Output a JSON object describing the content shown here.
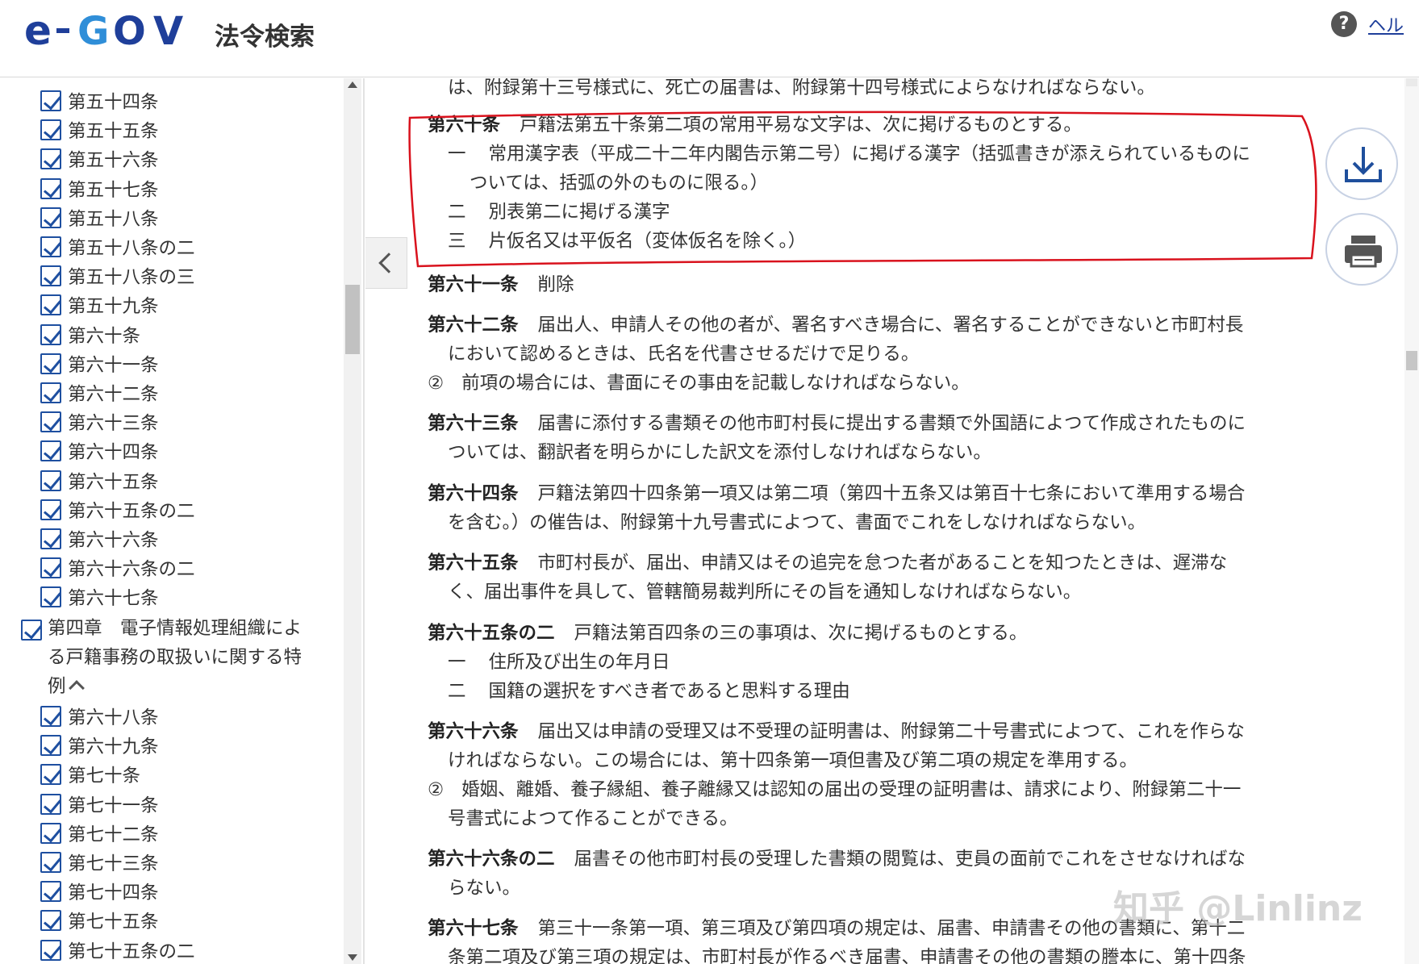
{
  "header": {
    "logo_text": "e-GOV",
    "site_title": "法令検索",
    "help_label": "ヘル"
  },
  "sidebar": {
    "items_top": [
      "第五十四条",
      "第五十五条",
      "第五十六条",
      "第五十七条",
      "第五十八条",
      "第五十八条の二",
      "第五十八条の三",
      "第五十九条",
      "第六十条",
      "第六十一条",
      "第六十二条",
      "第六十三条",
      "第六十四条",
      "第六十五条",
      "第六十五条の二",
      "第六十六条",
      "第六十六条の二",
      "第六十七条"
    ],
    "chapter": {
      "line1": "第四章　電子情報処理組織によ",
      "line2": "る戸籍事務の取扱いに関する特",
      "line3": "例"
    },
    "items_bottom": [
      "第六十八条",
      "第六十九条",
      "第七十条",
      "第七十一条",
      "第七十二条",
      "第七十三条",
      "第七十四条",
      "第七十五条",
      "第七十五条の二"
    ]
  },
  "content": {
    "top_fragment": "は、附録第十三号様式に、死亡の届書は、附録第十四号様式によらなければならない。",
    "a60": {
      "num": "第六十条",
      "text": "戸籍法第五十条第二項の常用平易な文字は、次に掲げるものとする。",
      "items": [
        {
          "n": "一",
          "line1": "常用漢字表（平成二十二年内閣告示第二号）に掲げる漢字（括弧書きが添えられているものに",
          "line2": "ついては、括弧の外のものに限る。）"
        },
        {
          "n": "二",
          "line1": "別表第二に掲げる漢字",
          "line2": ""
        },
        {
          "n": "三",
          "line1": "片仮名又は平仮名（変体仮名を除く。）",
          "line2": ""
        }
      ]
    },
    "a61": {
      "num": "第六十一条",
      "text": "削除"
    },
    "a62": {
      "num": "第六十二条",
      "line1": "届出人、申請人その他の者が、署名すべき場合に、署名することができないと市町村長",
      "line2": "において認めるときは、氏名を代書させるだけで足りる。",
      "para2_mark": "②",
      "para2": "前項の場合には、書面にその事由を記載しなければならない。"
    },
    "a63": {
      "num": "第六十三条",
      "line1": "届書に添付する書類その他市町村長に提出する書類で外国語によつて作成されたものに",
      "line2": "ついては、翻訳者を明らかにした訳文を添付しなければならない。"
    },
    "a64": {
      "num": "第六十四条",
      "line1": "戸籍法第四十四条第一項又は第二項（第四十五条又は第百十七条において準用する場合",
      "line2": "を含む。）の催告は、附録第十九号書式によつて、書面でこれをしなければならない。"
    },
    "a65": {
      "num": "第六十五条",
      "line1": "市町村長が、届出、申請又はその追完を怠つた者があることを知つたときは、遅滞な",
      "line2": "く、届出事件を具して、管轄簡易裁判所にその旨を通知しなければならない。"
    },
    "a65_2": {
      "num": "第六十五条の二",
      "text": "戸籍法第百四条の三の事項は、次に掲げるものとする。",
      "items": [
        {
          "n": "一",
          "text": "住所及び出生の年月日"
        },
        {
          "n": "二",
          "text": "国籍の選択をすべき者であると思料する理由"
        }
      ]
    },
    "a66": {
      "num": "第六十六条",
      "line1": "届出又は申請の受理又は不受理の証明書は、附録第二十号書式によつて、これを作らな",
      "line2": "ければならない。この場合には、第十四条第一項但書及び第二項の規定を準用する。",
      "para2_mark": "②",
      "para2_line1": "婚姻、離婚、養子縁組、養子離縁又は認知の届出の受理の証明書は、請求により、附録第二十一",
      "para2_line2": "号書式によつて作ることができる。"
    },
    "a66_2": {
      "num": "第六十六条の二",
      "line1": "届書その他市町村長の受理した書類の閲覧は、吏員の面前でこれをさせなければな",
      "line2": "らない。"
    },
    "a67": {
      "num": "第六十七条",
      "line1": "第三十一条第一項、第三項及び第四項の規定は、届書、申請書その他の書類に、第十二",
      "line2": "条第二項及び第三項の規定は、市町村長が作るべき届書、申請書その他の書類の謄本に、第十四条"
    }
  },
  "actions": {
    "download_icon": "download-icon",
    "print_icon": "printer-icon"
  },
  "watermark": "知乎 @Linlinz",
  "colors": {
    "brand": "#1f3f9a",
    "checkbox": "#1e4fa0",
    "highlight": "#d9121d"
  }
}
